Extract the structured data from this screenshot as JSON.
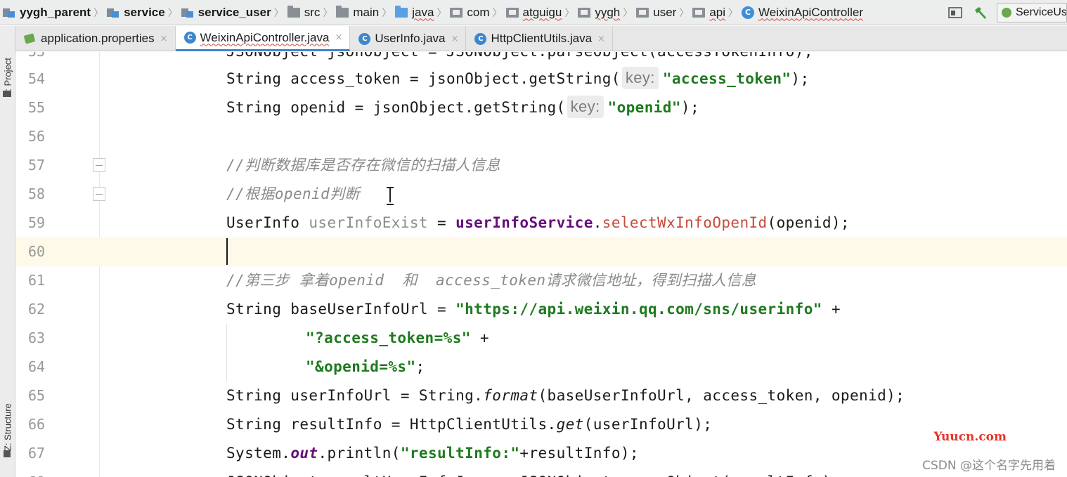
{
  "breadcrumb": [
    {
      "label": "yygh_parent",
      "icon": "module-icon",
      "bold": true
    },
    {
      "label": "service",
      "icon": "module-icon",
      "bold": true
    },
    {
      "label": "service_user",
      "icon": "module-icon",
      "bold": true
    },
    {
      "label": "src",
      "icon": "folder-icon"
    },
    {
      "label": "main",
      "icon": "folder-icon"
    },
    {
      "label": "java",
      "icon": "source-folder-icon"
    },
    {
      "label": "com",
      "icon": "package-icon"
    },
    {
      "label": "atguigu",
      "icon": "package-icon"
    },
    {
      "label": "yygh",
      "icon": "package-icon"
    },
    {
      "label": "user",
      "icon": "package-icon"
    },
    {
      "label": "api",
      "icon": "package-icon"
    },
    {
      "label": "WeixinApiController",
      "icon": "class-icon"
    }
  ],
  "toolbar": {
    "run_config_label": "ServiceUser",
    "class_icon_letter": "C"
  },
  "left_tools": {
    "project_label": "1: Project",
    "structure_label": "Z: Structure"
  },
  "tabs": [
    {
      "label": "application.properties",
      "icon": "properties-file-icon",
      "active": false
    },
    {
      "label": "WeixinApiController.java",
      "icon": "class-icon",
      "active": true
    },
    {
      "label": "UserInfo.java",
      "icon": "class-icon",
      "active": false
    },
    {
      "label": "HttpClientUtils.java",
      "icon": "class-icon",
      "active": false
    }
  ],
  "tab_close_glyph": "×",
  "editor": {
    "lines": [
      {
        "num": "53",
        "text": "JSONObject jsonObject = JSONObject.parseObject(accessTokenInfo);"
      },
      {
        "num": "54",
        "p1": "String access_token = jsonObject.getString(",
        "hint": "key:",
        "str": "\"access_token\"",
        "p2": ");"
      },
      {
        "num": "55",
        "p1": "String openid = jsonObject.getString(",
        "hint": "key:",
        "str": "\"openid\"",
        "p2": ");"
      },
      {
        "num": "56"
      },
      {
        "num": "57",
        "comment": "//判断数据库是否存在微信的扫描人信息"
      },
      {
        "num": "58",
        "comment": "//根据openid判断"
      },
      {
        "num": "59",
        "p1": "UserInfo ",
        "unused": "userInfoExist",
        "p2": " = ",
        "field": "userInfoService",
        "p3": ".",
        "method": "selectWxInfoOpenId",
        "p4": "(openid);"
      },
      {
        "num": "60"
      },
      {
        "num": "61",
        "comment": "//第三步 拿着openid  和  access_token请求微信地址，得到扫描人信息"
      },
      {
        "num": "62",
        "p1": "String baseUserInfoUrl = ",
        "str": "\"https://api.weixin.qq.com/sns/userinfo\"",
        "p2": " +"
      },
      {
        "num": "63",
        "str": "\"?access_token=%s\"",
        "p2": " +"
      },
      {
        "num": "64",
        "str": "\"&openid=%s\"",
        "p2": ";"
      },
      {
        "num": "65",
        "p1": "String userInfoUrl = String.",
        "ital": "format",
        "p2": "(baseUserInfoUrl, access_token, openid);"
      },
      {
        "num": "66",
        "p1": "String resultInfo = HttpClientUtils.",
        "ital": "get",
        "p2": "(userInfoUrl);"
      },
      {
        "num": "67",
        "p1": "System.",
        "sfield": "out",
        "p2": ".println(",
        "str": "\"resultInfo:\"",
        "p3": "+resultInfo);"
      },
      {
        "num": "68",
        "text": "JSONObject resultUserInfoJson = JSONObject.parseObject(resultInfo);"
      }
    ]
  },
  "watermark": {
    "site": "Yuucn.com",
    "author": "CSDN @这个名字先用着"
  },
  "colors": {
    "string": "#1f7a1f",
    "comment": "#8a8a8a",
    "field": "#660e7a",
    "method_unresolved": "#c74a3a",
    "current_line": "#fef9e8",
    "active_tab_underline": "#4083c9"
  }
}
